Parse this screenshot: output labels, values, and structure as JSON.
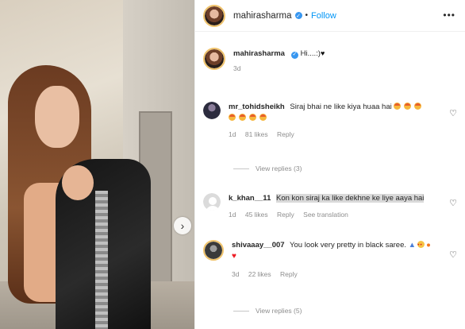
{
  "post": {
    "author": "mahirasharma",
    "follow_label": "Follow",
    "more_label": "•••",
    "dot": "•"
  },
  "caption": {
    "username": "mahirasharma",
    "text": "Hi....:)",
    "time": "3d"
  },
  "comments": [
    {
      "username": "mr_tohidsheikh",
      "text": "Siraj bhai ne like kiya huaa hai",
      "emoji_count": 7,
      "time": "1d",
      "likes": "81 likes",
      "reply_label": "Reply",
      "view_replies": "View replies (3)"
    },
    {
      "username": "k_khan__11",
      "text": "Kon kon siraj ka like dekhne ke liye aaya hai",
      "time": "1d",
      "likes": "45 likes",
      "reply_label": "Reply",
      "translation_label": "See translation"
    },
    {
      "username": "shivaaay__007",
      "text": "You look very pretty in black saree.",
      "time": "3d",
      "likes": "22 likes",
      "reply_label": "Reply",
      "view_replies": "View replies (5)"
    }
  ],
  "icons": {
    "heart": "♡",
    "next": "›",
    "black_heart": "♥",
    "red_heart": "♥",
    "drop": "💧",
    "fire": "🔥"
  }
}
